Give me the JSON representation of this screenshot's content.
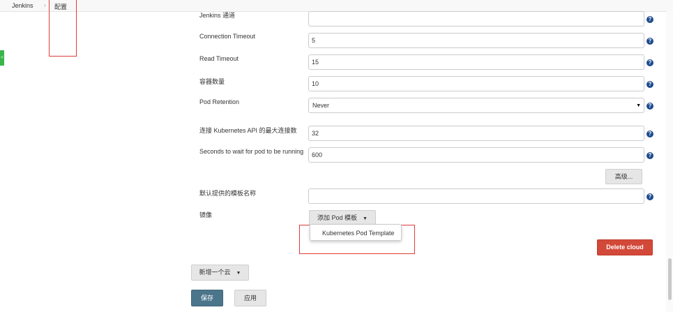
{
  "breadcrumb": {
    "root": "Jenkins",
    "separator": "›",
    "current": "配置"
  },
  "side_tab": {
    "label": "<"
  },
  "fields": {
    "channel": {
      "label": "Jenkins 通道",
      "value": ""
    },
    "connection_timeout": {
      "label": "Connection Timeout",
      "value": "5"
    },
    "read_timeout": {
      "label": "Read Timeout",
      "value": "15"
    },
    "container_count": {
      "label": "容器数量",
      "value": "10"
    },
    "pod_retention": {
      "label": "Pod Retention",
      "value": "Never",
      "arrow": "▼"
    },
    "max_connections": {
      "label": "连接 Kubernetes API 的最大连接数",
      "value": "32"
    },
    "pod_wait": {
      "label": "Seconds to wait for pod to be running",
      "value": "600"
    },
    "default_template_name": {
      "label": "默认提供的模板名称",
      "value": ""
    }
  },
  "help_icon": "?",
  "advanced_button": "高级...",
  "images": {
    "label": "镜像",
    "add_pod_template": "添加 Pod 模板",
    "caret": "▼",
    "menu_items": [
      "Kubernetes Pod Template"
    ]
  },
  "delete_cloud": "Delete cloud",
  "add_cloud": {
    "label": "新增一个云",
    "caret": "▼"
  },
  "save_button": "保存",
  "apply_button": "应用",
  "colors": {
    "help": "#1d4b8f",
    "delete": "#d24939",
    "save": "#4b758b",
    "highlight": "#e03b3b"
  }
}
